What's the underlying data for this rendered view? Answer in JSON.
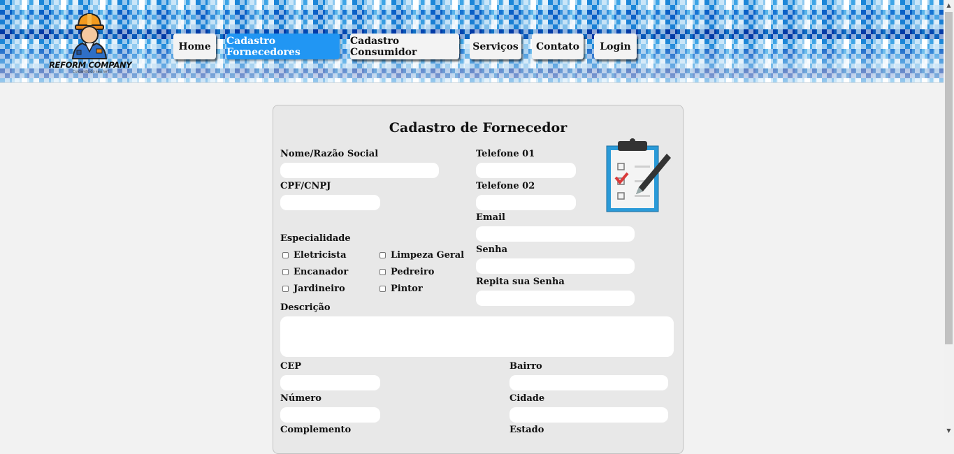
{
  "brand": {
    "name": "REFORM COMPANY",
    "tagline": "Cuidando do seu lar!"
  },
  "nav": {
    "items": [
      {
        "label": "Home"
      },
      {
        "label": "Cadastro Fornecedores"
      },
      {
        "label": "Cadastro Consumidor"
      },
      {
        "label": "Serviços"
      },
      {
        "label": "Contato"
      },
      {
        "label": "Login"
      }
    ],
    "active": "Cadastro Fornecedores",
    "active_color": "#2196f3"
  },
  "form": {
    "title": "Cadastro de Fornecedor",
    "fields": {
      "nome": {
        "label": "Nome/Razão Social",
        "value": ""
      },
      "cpf": {
        "label": "CPF/CNPJ",
        "value": ""
      },
      "telefone1": {
        "label": "Telefone 01",
        "value": ""
      },
      "telefone2": {
        "label": "Telefone 02",
        "value": ""
      },
      "email": {
        "label": "Email",
        "value": ""
      },
      "senha": {
        "label": "Senha",
        "value": ""
      },
      "repita_senha": {
        "label": "Repita sua Senha",
        "value": ""
      },
      "descricao": {
        "label": "Descrição",
        "value": ""
      },
      "cep": {
        "label": "CEP",
        "value": ""
      },
      "numero": {
        "label": "Número",
        "value": ""
      },
      "complemento": {
        "label": "Complemento",
        "value": ""
      },
      "bairro": {
        "label": "Bairro",
        "value": ""
      },
      "cidade": {
        "label": "Cidade",
        "value": ""
      },
      "estado": {
        "label": "Estado",
        "value": ""
      }
    },
    "especialidade": {
      "label": "Especialidade",
      "options": [
        {
          "label": "Eletricista",
          "checked": false
        },
        {
          "label": "Limpeza Geral",
          "checked": false
        },
        {
          "label": "Encanador",
          "checked": false
        },
        {
          "label": "Pedreiro",
          "checked": false
        },
        {
          "label": "Jardineiro",
          "checked": false
        },
        {
          "label": "Pintor",
          "checked": false
        }
      ]
    },
    "illustration_icon": "clipboard-checklist-pen-icon"
  }
}
